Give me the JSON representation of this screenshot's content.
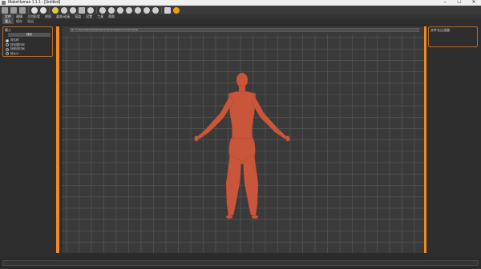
{
  "window": {
    "title": "MakeHuman 1.1.1 - [Untitled]",
    "controls": [
      "–",
      "☐",
      "✕"
    ]
  },
  "toolbar": {
    "icons": [
      {
        "name": "file-new-icon",
        "color": "#9a9a9a"
      },
      {
        "name": "file-save-icon",
        "color": "#9a9a9a"
      },
      {
        "name": "file-export-icon",
        "color": "#9a9a9a"
      },
      {
        "name": "undo-icon",
        "color": "#e0e0e0"
      },
      {
        "name": "redo-icon",
        "color": "#e0e0e0"
      },
      {
        "name": "reset-icon",
        "color": "#d9c84a"
      },
      {
        "name": "smooth-icon",
        "color": "#cfcfcf"
      },
      {
        "name": "wireframe-icon",
        "color": "#cfcfcf"
      },
      {
        "name": "background-icon",
        "color": "#b8b8b8"
      },
      {
        "name": "pose-icon",
        "color": "#cfcfcf"
      },
      {
        "name": "front-view-icon",
        "color": "#d0d0d0"
      },
      {
        "name": "back-view-icon",
        "color": "#d0d0d0"
      },
      {
        "name": "left-view-icon",
        "color": "#d0d0d0"
      },
      {
        "name": "right-view-icon",
        "color": "#d0d0d0"
      },
      {
        "name": "top-view-icon",
        "color": "#d0d0d0"
      },
      {
        "name": "bottom-view-icon",
        "color": "#d0d0d0"
      },
      {
        "name": "reset-camera-icon",
        "color": "#d0d0d0"
      },
      {
        "name": "grid-icon",
        "color": "#cfcfcf"
      },
      {
        "name": "help-icon",
        "color": "#e8a020"
      }
    ]
  },
  "menu": {
    "tabs": [
      "文件",
      "建模",
      "几何形状",
      "材质",
      "姿态/动画",
      "渲染",
      "设置",
      "工具",
      "帮助"
    ],
    "active_index": 0
  },
  "subtabs": {
    "items": [
      "载入",
      "保存",
      "导出"
    ],
    "active_index": 0
  },
  "left_panel": {
    "box_title": "载入",
    "option_header": "排序",
    "options": [
      "按名称",
      "按创建时间",
      "按修改时间",
      "按大小"
    ],
    "checked_index": 0
  },
  "viewport": {
    "path_text": "C:/Users/Administrator/Documents/makehuman/v1/models",
    "background": "#3a3a3a",
    "grid_color": "#5a5a5a",
    "model_color": "#c9553a"
  },
  "right_panel": {
    "box_title": "文件名过滤器"
  },
  "accent_color": "#f08a24"
}
